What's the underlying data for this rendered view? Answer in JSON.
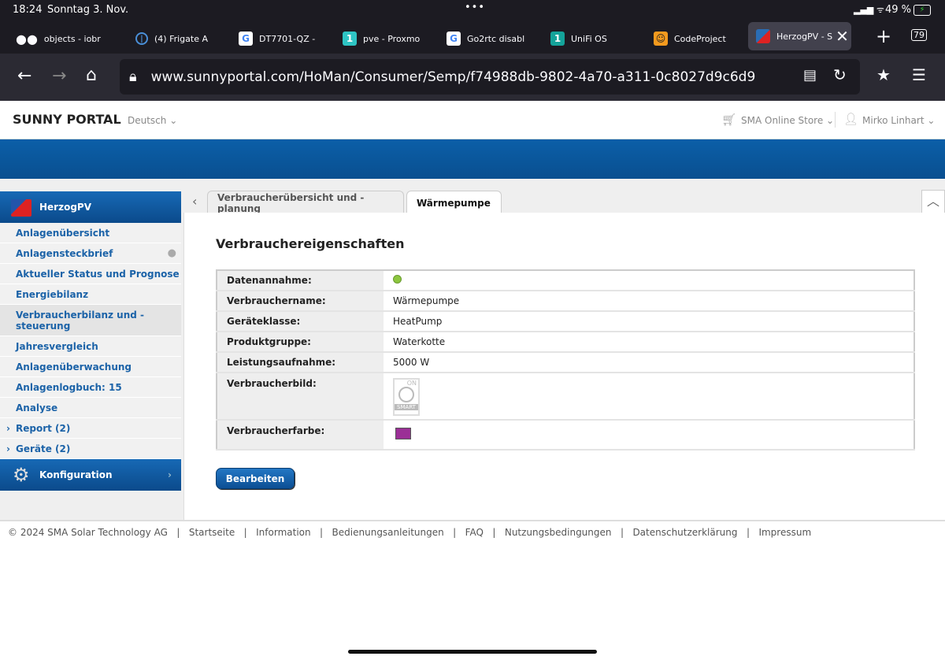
{
  "status": {
    "time": "18:24",
    "date": "Sonntag 3. Nov.",
    "battery": "49 %"
  },
  "browser_tabs": [
    {
      "label": "objects - iobr",
      "icon": "mask-icon"
    },
    {
      "label": "(4) Frigate A",
      "icon": "frigate-icon"
    },
    {
      "label": "DT7701-QZ -",
      "icon": "google-icon",
      "fav": "G"
    },
    {
      "label": "pve - Proxmo",
      "icon": "one-icon",
      "fav": "1"
    },
    {
      "label": "Go2rtc disabl",
      "icon": "google-icon",
      "fav": "G"
    },
    {
      "label": "UniFi OS",
      "icon": "one-icon",
      "fav": "1"
    },
    {
      "label": "CodeProject",
      "icon": "codeproject-icon"
    },
    {
      "label": "HerzogPV - S",
      "icon": "sma-icon"
    }
  ],
  "tab_count": "79",
  "url": "www.sunnyportal.com/HoMan/Consumer/Semp/f74988db-9802-4a70-a311-0c8027d9c6d9",
  "header": {
    "logo": "SUNNY PORTAL",
    "language": "Deutsch",
    "store": "SMA Online Store",
    "user": "Mirko Linhart"
  },
  "sidebar": {
    "plant": "HerzogPV",
    "items": [
      "Anlagenübersicht",
      "Anlagensteckbrief",
      "Aktueller Status und Prognose",
      "Energiebilanz",
      "Verbraucherbilanz und -steuerung",
      "Jahresvergleich",
      "Anlagenüberwachung",
      "Anlagenlogbuch: 15",
      "Analyse",
      "Report (2)",
      "Geräte (2)"
    ],
    "config": "Konfiguration"
  },
  "tabs": [
    "Verbraucherübersicht und -planung",
    "Wärmepumpe"
  ],
  "main": {
    "title": "Verbrauchereigenschaften",
    "rows": [
      {
        "label": "Datenannahme:",
        "value": ""
      },
      {
        "label": "Verbrauchername:",
        "value": "Wärmepumpe"
      },
      {
        "label": "Geräteklasse:",
        "value": "HeatPump"
      },
      {
        "label": "Produktgruppe:",
        "value": "Waterkotte"
      },
      {
        "label": "Leistungsaufnahme:",
        "value": "5000 W"
      },
      {
        "label": "Verbraucherbild:",
        "value": ""
      },
      {
        "label": "Verbraucherfarbe:",
        "value": ""
      }
    ],
    "image_on": "ON",
    "image_smart": "SMART",
    "consumer_color": "#9b2f96",
    "status_color": "#8cc63f",
    "edit_button": "Bearbeiten"
  },
  "footer": [
    "© 2024 SMA Solar Technology AG",
    "Startseite",
    "Information",
    "Bedienungsanleitungen",
    "FAQ",
    "Nutzungsbedingungen",
    "Datenschutzerklärung",
    "Impressum"
  ]
}
